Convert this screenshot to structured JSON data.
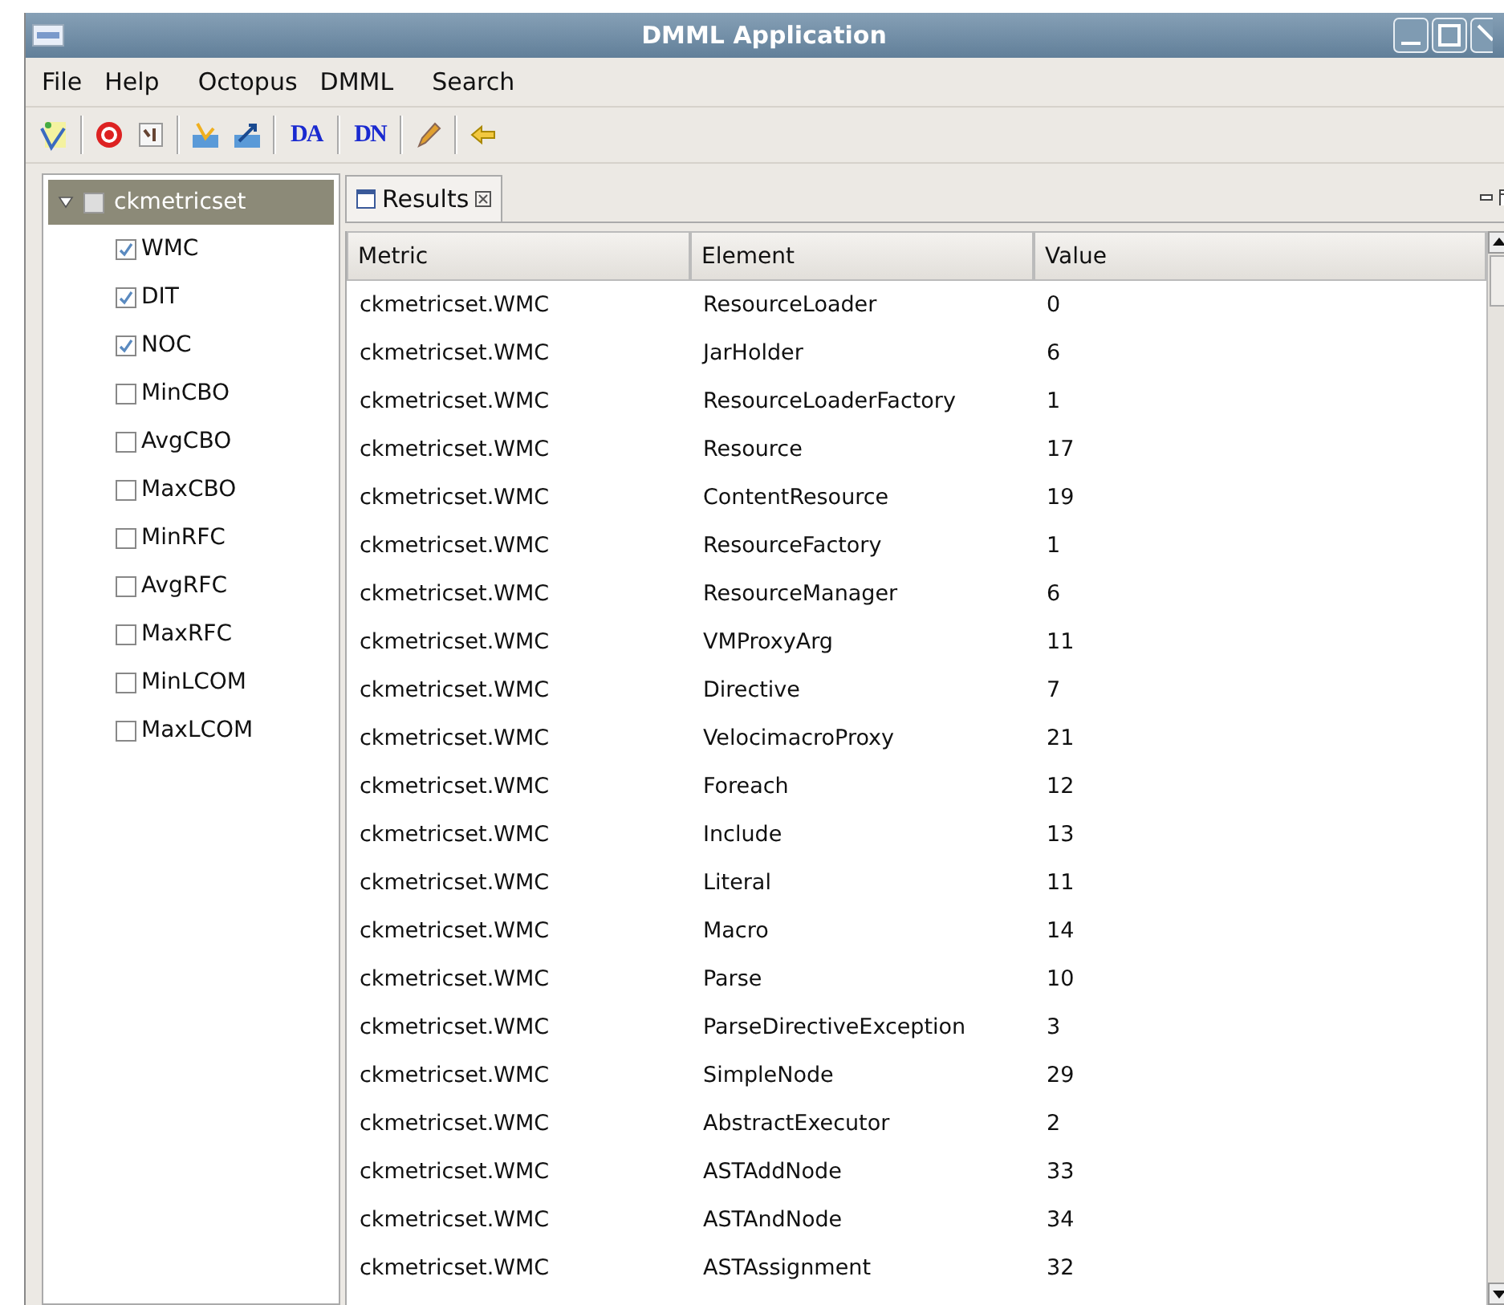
{
  "window": {
    "title": "DMML Application"
  },
  "menu": [
    "File",
    "Help",
    "Octopus",
    "DMML",
    "Search"
  ],
  "toolbar": [
    {
      "kind": "chart"
    },
    {
      "kind": "sep"
    },
    {
      "kind": "target"
    },
    {
      "kind": "doc"
    },
    {
      "kind": "sep"
    },
    {
      "kind": "import"
    },
    {
      "kind": "export"
    },
    {
      "kind": "sep"
    },
    {
      "kind": "text",
      "label": "DA"
    },
    {
      "kind": "sep"
    },
    {
      "kind": "text",
      "label": "DN"
    },
    {
      "kind": "sep"
    },
    {
      "kind": "pen"
    },
    {
      "kind": "sep"
    },
    {
      "kind": "back"
    }
  ],
  "tree": {
    "label": "ckmetricset",
    "expanded": true,
    "checked": false,
    "selected": true,
    "children": [
      {
        "label": "WMC",
        "checked": true
      },
      {
        "label": "DIT",
        "checked": true
      },
      {
        "label": "NOC",
        "checked": true
      },
      {
        "label": "MinCBO",
        "checked": false
      },
      {
        "label": "AvgCBO",
        "checked": false
      },
      {
        "label": "MaxCBO",
        "checked": false
      },
      {
        "label": "MinRFC",
        "checked": false
      },
      {
        "label": "AvgRFC",
        "checked": false
      },
      {
        "label": "MaxRFC",
        "checked": false
      },
      {
        "label": "MinLCOM",
        "checked": false
      },
      {
        "label": "MaxLCOM",
        "checked": false
      }
    ]
  },
  "results": {
    "tab": "Results",
    "columns": [
      "Metric",
      "Element",
      "Value"
    ],
    "rows": [
      [
        "ckmetricset.WMC",
        "ResourceLoader",
        "0"
      ],
      [
        "ckmetricset.WMC",
        "JarHolder",
        "6"
      ],
      [
        "ckmetricset.WMC",
        "ResourceLoaderFactory",
        "1"
      ],
      [
        "ckmetricset.WMC",
        "Resource",
        "17"
      ],
      [
        "ckmetricset.WMC",
        "ContentResource",
        "19"
      ],
      [
        "ckmetricset.WMC",
        "ResourceFactory",
        "1"
      ],
      [
        "ckmetricset.WMC",
        "ResourceManager",
        "6"
      ],
      [
        "ckmetricset.WMC",
        "VMProxyArg",
        "11"
      ],
      [
        "ckmetricset.WMC",
        "Directive",
        "7"
      ],
      [
        "ckmetricset.WMC",
        "VelocimacroProxy",
        "21"
      ],
      [
        "ckmetricset.WMC",
        "Foreach",
        "12"
      ],
      [
        "ckmetricset.WMC",
        "Include",
        "13"
      ],
      [
        "ckmetricset.WMC",
        "Literal",
        "11"
      ],
      [
        "ckmetricset.WMC",
        "Macro",
        "14"
      ],
      [
        "ckmetricset.WMC",
        "Parse",
        "10"
      ],
      [
        "ckmetricset.WMC",
        "ParseDirectiveException",
        "3"
      ],
      [
        "ckmetricset.WMC",
        "SimpleNode",
        "29"
      ],
      [
        "ckmetricset.WMC",
        "AbstractExecutor",
        "2"
      ],
      [
        "ckmetricset.WMC",
        "ASTAddNode",
        "33"
      ],
      [
        "ckmetricset.WMC",
        "ASTAndNode",
        "34"
      ],
      [
        "ckmetricset.WMC",
        "ASTAssignment",
        "32"
      ]
    ]
  }
}
